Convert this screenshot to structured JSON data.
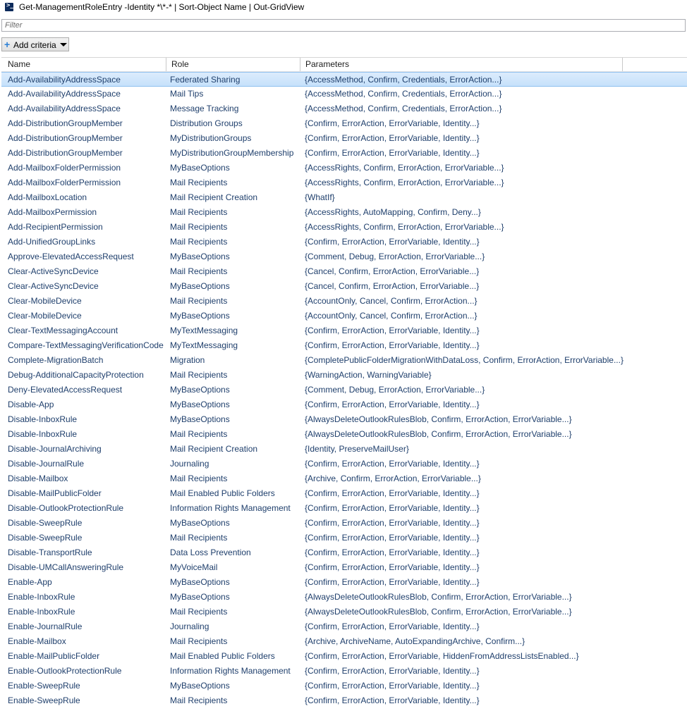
{
  "window": {
    "title": "Get-ManagementRoleEntry -Identity *\\*-* | Sort-Object Name | Out-GridView",
    "icon": "powershell-icon"
  },
  "filter": {
    "placeholder": "Filter",
    "value": ""
  },
  "toolbar": {
    "add_criteria_label": "Add criteria"
  },
  "grid": {
    "columns": [
      "Name",
      "Role",
      "Parameters"
    ],
    "selected_row": 0,
    "rows": [
      [
        "Add-AvailabilityAddressSpace",
        "Federated Sharing",
        "{AccessMethod, Confirm, Credentials, ErrorAction...}"
      ],
      [
        "Add-AvailabilityAddressSpace",
        "Mail Tips",
        "{AccessMethod, Confirm, Credentials, ErrorAction...}"
      ],
      [
        "Add-AvailabilityAddressSpace",
        "Message Tracking",
        "{AccessMethod, Confirm, Credentials, ErrorAction...}"
      ],
      [
        "Add-DistributionGroupMember",
        "Distribution Groups",
        "{Confirm, ErrorAction, ErrorVariable, Identity...}"
      ],
      [
        "Add-DistributionGroupMember",
        "MyDistributionGroups",
        "{Confirm, ErrorAction, ErrorVariable, Identity...}"
      ],
      [
        "Add-DistributionGroupMember",
        "MyDistributionGroupMembership",
        "{Confirm, ErrorAction, ErrorVariable, Identity...}"
      ],
      [
        "Add-MailboxFolderPermission",
        "MyBaseOptions",
        "{AccessRights, Confirm, ErrorAction, ErrorVariable...}"
      ],
      [
        "Add-MailboxFolderPermission",
        "Mail Recipients",
        "{AccessRights, Confirm, ErrorAction, ErrorVariable...}"
      ],
      [
        "Add-MailboxLocation",
        "Mail Recipient Creation",
        "{WhatIf}"
      ],
      [
        "Add-MailboxPermission",
        "Mail Recipients",
        "{AccessRights, AutoMapping, Confirm, Deny...}"
      ],
      [
        "Add-RecipientPermission",
        "Mail Recipients",
        "{AccessRights, Confirm, ErrorAction, ErrorVariable...}"
      ],
      [
        "Add-UnifiedGroupLinks",
        "Mail Recipients",
        "{Confirm, ErrorAction, ErrorVariable, Identity...}"
      ],
      [
        "Approve-ElevatedAccessRequest",
        "MyBaseOptions",
        "{Comment, Debug, ErrorAction, ErrorVariable...}"
      ],
      [
        "Clear-ActiveSyncDevice",
        "Mail Recipients",
        "{Cancel, Confirm, ErrorAction, ErrorVariable...}"
      ],
      [
        "Clear-ActiveSyncDevice",
        "MyBaseOptions",
        "{Cancel, Confirm, ErrorAction, ErrorVariable...}"
      ],
      [
        "Clear-MobileDevice",
        "Mail Recipients",
        "{AccountOnly, Cancel, Confirm, ErrorAction...}"
      ],
      [
        "Clear-MobileDevice",
        "MyBaseOptions",
        "{AccountOnly, Cancel, Confirm, ErrorAction...}"
      ],
      [
        "Clear-TextMessagingAccount",
        "MyTextMessaging",
        "{Confirm, ErrorAction, ErrorVariable, Identity...}"
      ],
      [
        "Compare-TextMessagingVerificationCode",
        "MyTextMessaging",
        "{Confirm, ErrorAction, ErrorVariable, Identity...}"
      ],
      [
        "Complete-MigrationBatch",
        "Migration",
        "{CompletePublicFolderMigrationWithDataLoss, Confirm, ErrorAction, ErrorVariable...}"
      ],
      [
        "Debug-AdditionalCapacityProtection",
        "Mail Recipients",
        "{WarningAction, WarningVariable}"
      ],
      [
        "Deny-ElevatedAccessRequest",
        "MyBaseOptions",
        "{Comment, Debug, ErrorAction, ErrorVariable...}"
      ],
      [
        "Disable-App",
        "MyBaseOptions",
        "{Confirm, ErrorAction, ErrorVariable, Identity...}"
      ],
      [
        "Disable-InboxRule",
        "MyBaseOptions",
        "{AlwaysDeleteOutlookRulesBlob, Confirm, ErrorAction, ErrorVariable...}"
      ],
      [
        "Disable-InboxRule",
        "Mail Recipients",
        "{AlwaysDeleteOutlookRulesBlob, Confirm, ErrorAction, ErrorVariable...}"
      ],
      [
        "Disable-JournalArchiving",
        "Mail Recipient Creation",
        "{Identity, PreserveMailUser}"
      ],
      [
        "Disable-JournalRule",
        "Journaling",
        "{Confirm, ErrorAction, ErrorVariable, Identity...}"
      ],
      [
        "Disable-Mailbox",
        "Mail Recipients",
        "{Archive, Confirm, ErrorAction, ErrorVariable...}"
      ],
      [
        "Disable-MailPublicFolder",
        "Mail Enabled Public Folders",
        "{Confirm, ErrorAction, ErrorVariable, Identity...}"
      ],
      [
        "Disable-OutlookProtectionRule",
        "Information Rights Management",
        "{Confirm, ErrorAction, ErrorVariable, Identity...}"
      ],
      [
        "Disable-SweepRule",
        "MyBaseOptions",
        "{Confirm, ErrorAction, ErrorVariable, Identity...}"
      ],
      [
        "Disable-SweepRule",
        "Mail Recipients",
        "{Confirm, ErrorAction, ErrorVariable, Identity...}"
      ],
      [
        "Disable-TransportRule",
        "Data Loss Prevention",
        "{Confirm, ErrorAction, ErrorVariable, Identity...}"
      ],
      [
        "Disable-UMCallAnsweringRule",
        "MyVoiceMail",
        "{Confirm, ErrorAction, ErrorVariable, Identity...}"
      ],
      [
        "Enable-App",
        "MyBaseOptions",
        "{Confirm, ErrorAction, ErrorVariable, Identity...}"
      ],
      [
        "Enable-InboxRule",
        "MyBaseOptions",
        "{AlwaysDeleteOutlookRulesBlob, Confirm, ErrorAction, ErrorVariable...}"
      ],
      [
        "Enable-InboxRule",
        "Mail Recipients",
        "{AlwaysDeleteOutlookRulesBlob, Confirm, ErrorAction, ErrorVariable...}"
      ],
      [
        "Enable-JournalRule",
        "Journaling",
        "{Confirm, ErrorAction, ErrorVariable, Identity...}"
      ],
      [
        "Enable-Mailbox",
        "Mail Recipients",
        "{Archive, ArchiveName, AutoExpandingArchive, Confirm...}"
      ],
      [
        "Enable-MailPublicFolder",
        "Mail Enabled Public Folders",
        "{Confirm, ErrorAction, ErrorVariable, HiddenFromAddressListsEnabled...}"
      ],
      [
        "Enable-OutlookProtectionRule",
        "Information Rights Management",
        "{Confirm, ErrorAction, ErrorVariable, Identity...}"
      ],
      [
        "Enable-SweepRule",
        "MyBaseOptions",
        "{Confirm, ErrorAction, ErrorVariable, Identity...}"
      ],
      [
        "Enable-SweepRule",
        "Mail Recipients",
        "{Confirm, ErrorAction, ErrorVariable, Identity...}"
      ]
    ]
  }
}
